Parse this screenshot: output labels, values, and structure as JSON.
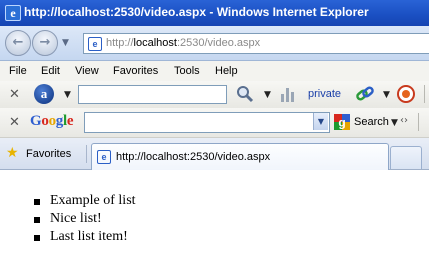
{
  "window": {
    "title": "http://localhost:2530/video.aspx - Windows Internet Explorer"
  },
  "address": {
    "url_prefix": "http://",
    "url_host": "localhost",
    "url_rest": ":2530/video.aspx"
  },
  "menu": [
    "File",
    "Edit",
    "View",
    "Favorites",
    "Tools",
    "Help"
  ],
  "ask_toolbar": {
    "link": "private"
  },
  "google_toolbar": {
    "logo": [
      "G",
      "o",
      "o",
      "g",
      "l",
      "e"
    ],
    "logo_colors": [
      "#2f5fd0",
      "#d8281e",
      "#e6a500",
      "#2f5fd0",
      "#1e9a2e",
      "#d8281e"
    ],
    "search_label": "Search"
  },
  "tabs": {
    "favorites_label": "Favorites",
    "active_tab": "http://localhost:2530/video.aspx"
  },
  "page": {
    "list": [
      "Example of list",
      "Nice list!",
      "Last list item!"
    ]
  }
}
